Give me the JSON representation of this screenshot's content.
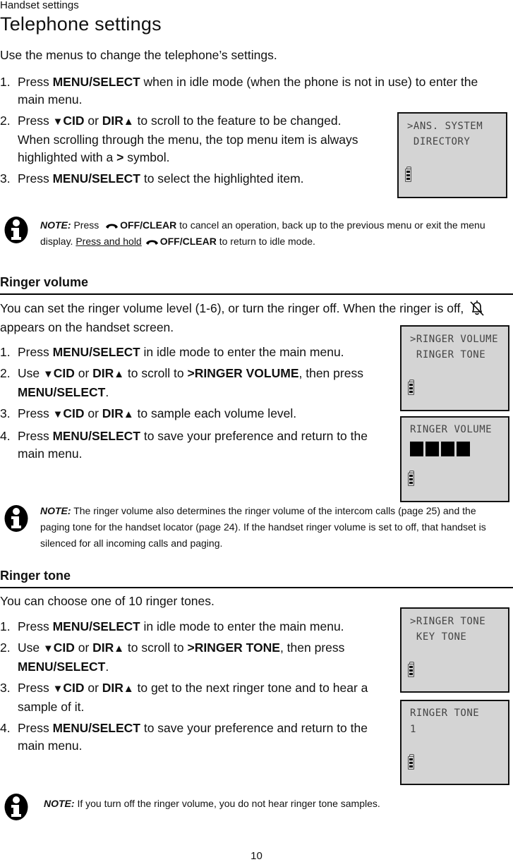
{
  "running_head": "Handset settings",
  "page_title": "Telephone settings",
  "intro": "Use the menus to change the telephone’s settings.",
  "main_steps": [
    {
      "num": "1.",
      "parts": [
        "Press ",
        "MENU/",
        "SELECT",
        " when in idle mode (when the phone is not in use) to enter the main menu."
      ]
    },
    {
      "num": "2.",
      "parts": [
        "Press ",
        "▼",
        "CID",
        " or ",
        "DIR",
        "▲",
        " to scroll to the feature to be changed. When scrolling through the menu, the top menu item is always highlighted with a ",
        ">",
        " symbol."
      ]
    },
    {
      "num": "3.",
      "parts": [
        "Press ",
        "MENU",
        "/SELECT",
        " to select the highlighted item."
      ]
    }
  ],
  "screens": {
    "main_menu": {
      "lines": [
        ">ANS. SYSTEM",
        " DIRECTORY"
      ]
    },
    "ringer_volume_menu": {
      "lines": [
        ">RINGER VOLUME",
        " RINGER TONE"
      ]
    },
    "ringer_volume_level": {
      "lines": [
        "RINGER VOLUME"
      ],
      "level_bars_shown": 4,
      "level_max": 6
    },
    "ringer_tone_menu": {
      "lines": [
        ">RINGER TONE",
        " KEY TONE"
      ]
    },
    "ringer_tone_value": {
      "lines": [
        "RINGER TONE",
        "1"
      ]
    }
  },
  "notes": {
    "note1": {
      "label": "NOTE:",
      "t1": " Press ",
      "k1": "OFF/CLEAR",
      "t2": " to cancel an operation, back up to the previous menu or exit the menu display. ",
      "u1": "Press and hold",
      "k2": "OFF/CLEAR",
      "t3": " to return to idle mode."
    },
    "note2": {
      "label": "NOTE:",
      "text": " The ringer volume also determines the ringer volume of the intercom calls (page 25) and the paging tone for the handset locator (page 24). If the handset ringer volume is set to off, that handset is silenced for all incoming calls and paging."
    },
    "note3": {
      "label": "NOTE:",
      "text": " If you turn off the ringer volume, you do not hear ringer tone samples."
    }
  },
  "ringer_volume": {
    "heading": "Ringer volume",
    "desc_a": "You can set the ringer volume level (1-6), or turn the ringer off. When the ringer is off, ",
    "desc_b": " appears on the handset screen.",
    "steps": [
      {
        "num": "1.",
        "a": "Press ",
        "b": "MENU/",
        "c": "SELECT",
        "d": " in idle mode to enter the main menu."
      },
      {
        "num": "2.",
        "a": "Use ",
        "tri_down": "▼",
        "cid": "CID",
        "or": " or ",
        "dir": "DIR",
        "tri_up": "▲",
        "e": " to scroll to ",
        "f": ">RINGER VOLUME",
        "g": ", then press ",
        "h": "MENU",
        "i": "/SELECT",
        "j": "."
      },
      {
        "num": "3.",
        "a": "Press ",
        "tri_down": "▼",
        "cid": "CID",
        "or": " or ",
        "dir": "DIR",
        "tri_up": "▲",
        "e": " to sample each volume level."
      },
      {
        "num": "4.",
        "a": "Press ",
        "h": "MENU",
        "i": "/SELECT",
        "e": " to save your preference and return to the main menu."
      }
    ]
  },
  "ringer_tone": {
    "heading": "Ringer tone",
    "desc": "You can choose one of 10 ringer tones.",
    "steps": [
      {
        "num": "1.",
        "a": "Press ",
        "b": "MENU/",
        "c": "SELECT",
        "d": " in idle mode to enter the main menu."
      },
      {
        "num": "2.",
        "a": "Use ",
        "tri_down": "▼",
        "cid": "CID",
        "or": " or ",
        "dir": "DIR",
        "tri_up": "▲",
        "e": " to scroll to ",
        "f": ">RINGER TONE",
        "g": ", then press ",
        "h": "MENU",
        "i": "/SELECT",
        "j": "."
      },
      {
        "num": "3.",
        "a": "Press ",
        "tri_down": "▼",
        "cid": "CID",
        "or": " or ",
        "dir": "DIR",
        "tri_up": "▲",
        "e": " to get to the next ringer tone and to hear a sample of it."
      },
      {
        "num": "4.",
        "a": "Press ",
        "h": "MENU",
        "i": "/SELECT",
        "e": " to save your preference and return to the main menu."
      }
    ]
  },
  "page_number": "10"
}
